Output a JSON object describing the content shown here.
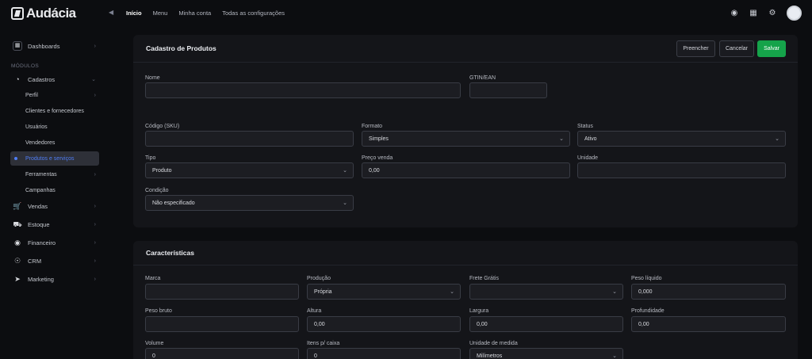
{
  "app": {
    "logo_text": "Audácia"
  },
  "topnav": [
    "Início",
    "Menu",
    "Minha conta",
    "Todas as configurações"
  ],
  "top_icons": [
    "palette-icon",
    "grid-icon",
    "gear-icon"
  ],
  "sidebar": {
    "dashboards": "Dashboards",
    "section_label": "MÓDULOS",
    "cadastros": "Cadastros",
    "sub_items": [
      "Perfil",
      "Clientes e fornecedores",
      "Usuários",
      "Vendedores",
      "Produtos e serviços",
      "Ferramentas",
      "Campanhas"
    ],
    "modules": [
      "Vendas",
      "Estoque",
      "Financeiro",
      "CRM",
      "Marketing"
    ]
  },
  "product_form": {
    "title": "Cadastro de Produtos",
    "buttons": {
      "fill": "Preencher",
      "cancel": "Cancelar",
      "save": "Salvar"
    },
    "fields": {
      "nome": {
        "label": "Nome",
        "value": ""
      },
      "gtin": {
        "label": "GTIN/EAN",
        "value": ""
      },
      "sku": {
        "label": "Código (SKU)",
        "value": ""
      },
      "formato": {
        "label": "Formato",
        "value": "Simples"
      },
      "status": {
        "label": "Status",
        "value": "Ativo"
      },
      "tipo": {
        "label": "Tipo",
        "value": "Produto"
      },
      "preco": {
        "label": "Preço venda",
        "value": "0,00"
      },
      "unidade": {
        "label": "Unidade",
        "value": ""
      },
      "condicao": {
        "label": "Condição",
        "value": "Não especificado"
      }
    }
  },
  "characteristics": {
    "title": "Características",
    "fields": {
      "marca": {
        "label": "Marca",
        "value": ""
      },
      "producao": {
        "label": "Produção",
        "value": "Própria"
      },
      "frete": {
        "label": "Frete Grátis",
        "value": ""
      },
      "peso_liquido": {
        "label": "Peso líquido",
        "value": "0,000"
      },
      "peso_bruto": {
        "label": "Peso bruto",
        "value": ""
      },
      "altura": {
        "label": "Altura",
        "value": "0,00"
      },
      "largura": {
        "label": "Largura",
        "value": "0,00"
      },
      "profundidade": {
        "label": "Profundidade",
        "value": "0,00"
      },
      "volume": {
        "label": "Volume",
        "value": "0"
      },
      "itens_caixa": {
        "label": "Itens p/ caixa",
        "value": "0"
      },
      "unidade_medida": {
        "label": "Unidade de medida",
        "value": "Milímetros"
      }
    }
  }
}
